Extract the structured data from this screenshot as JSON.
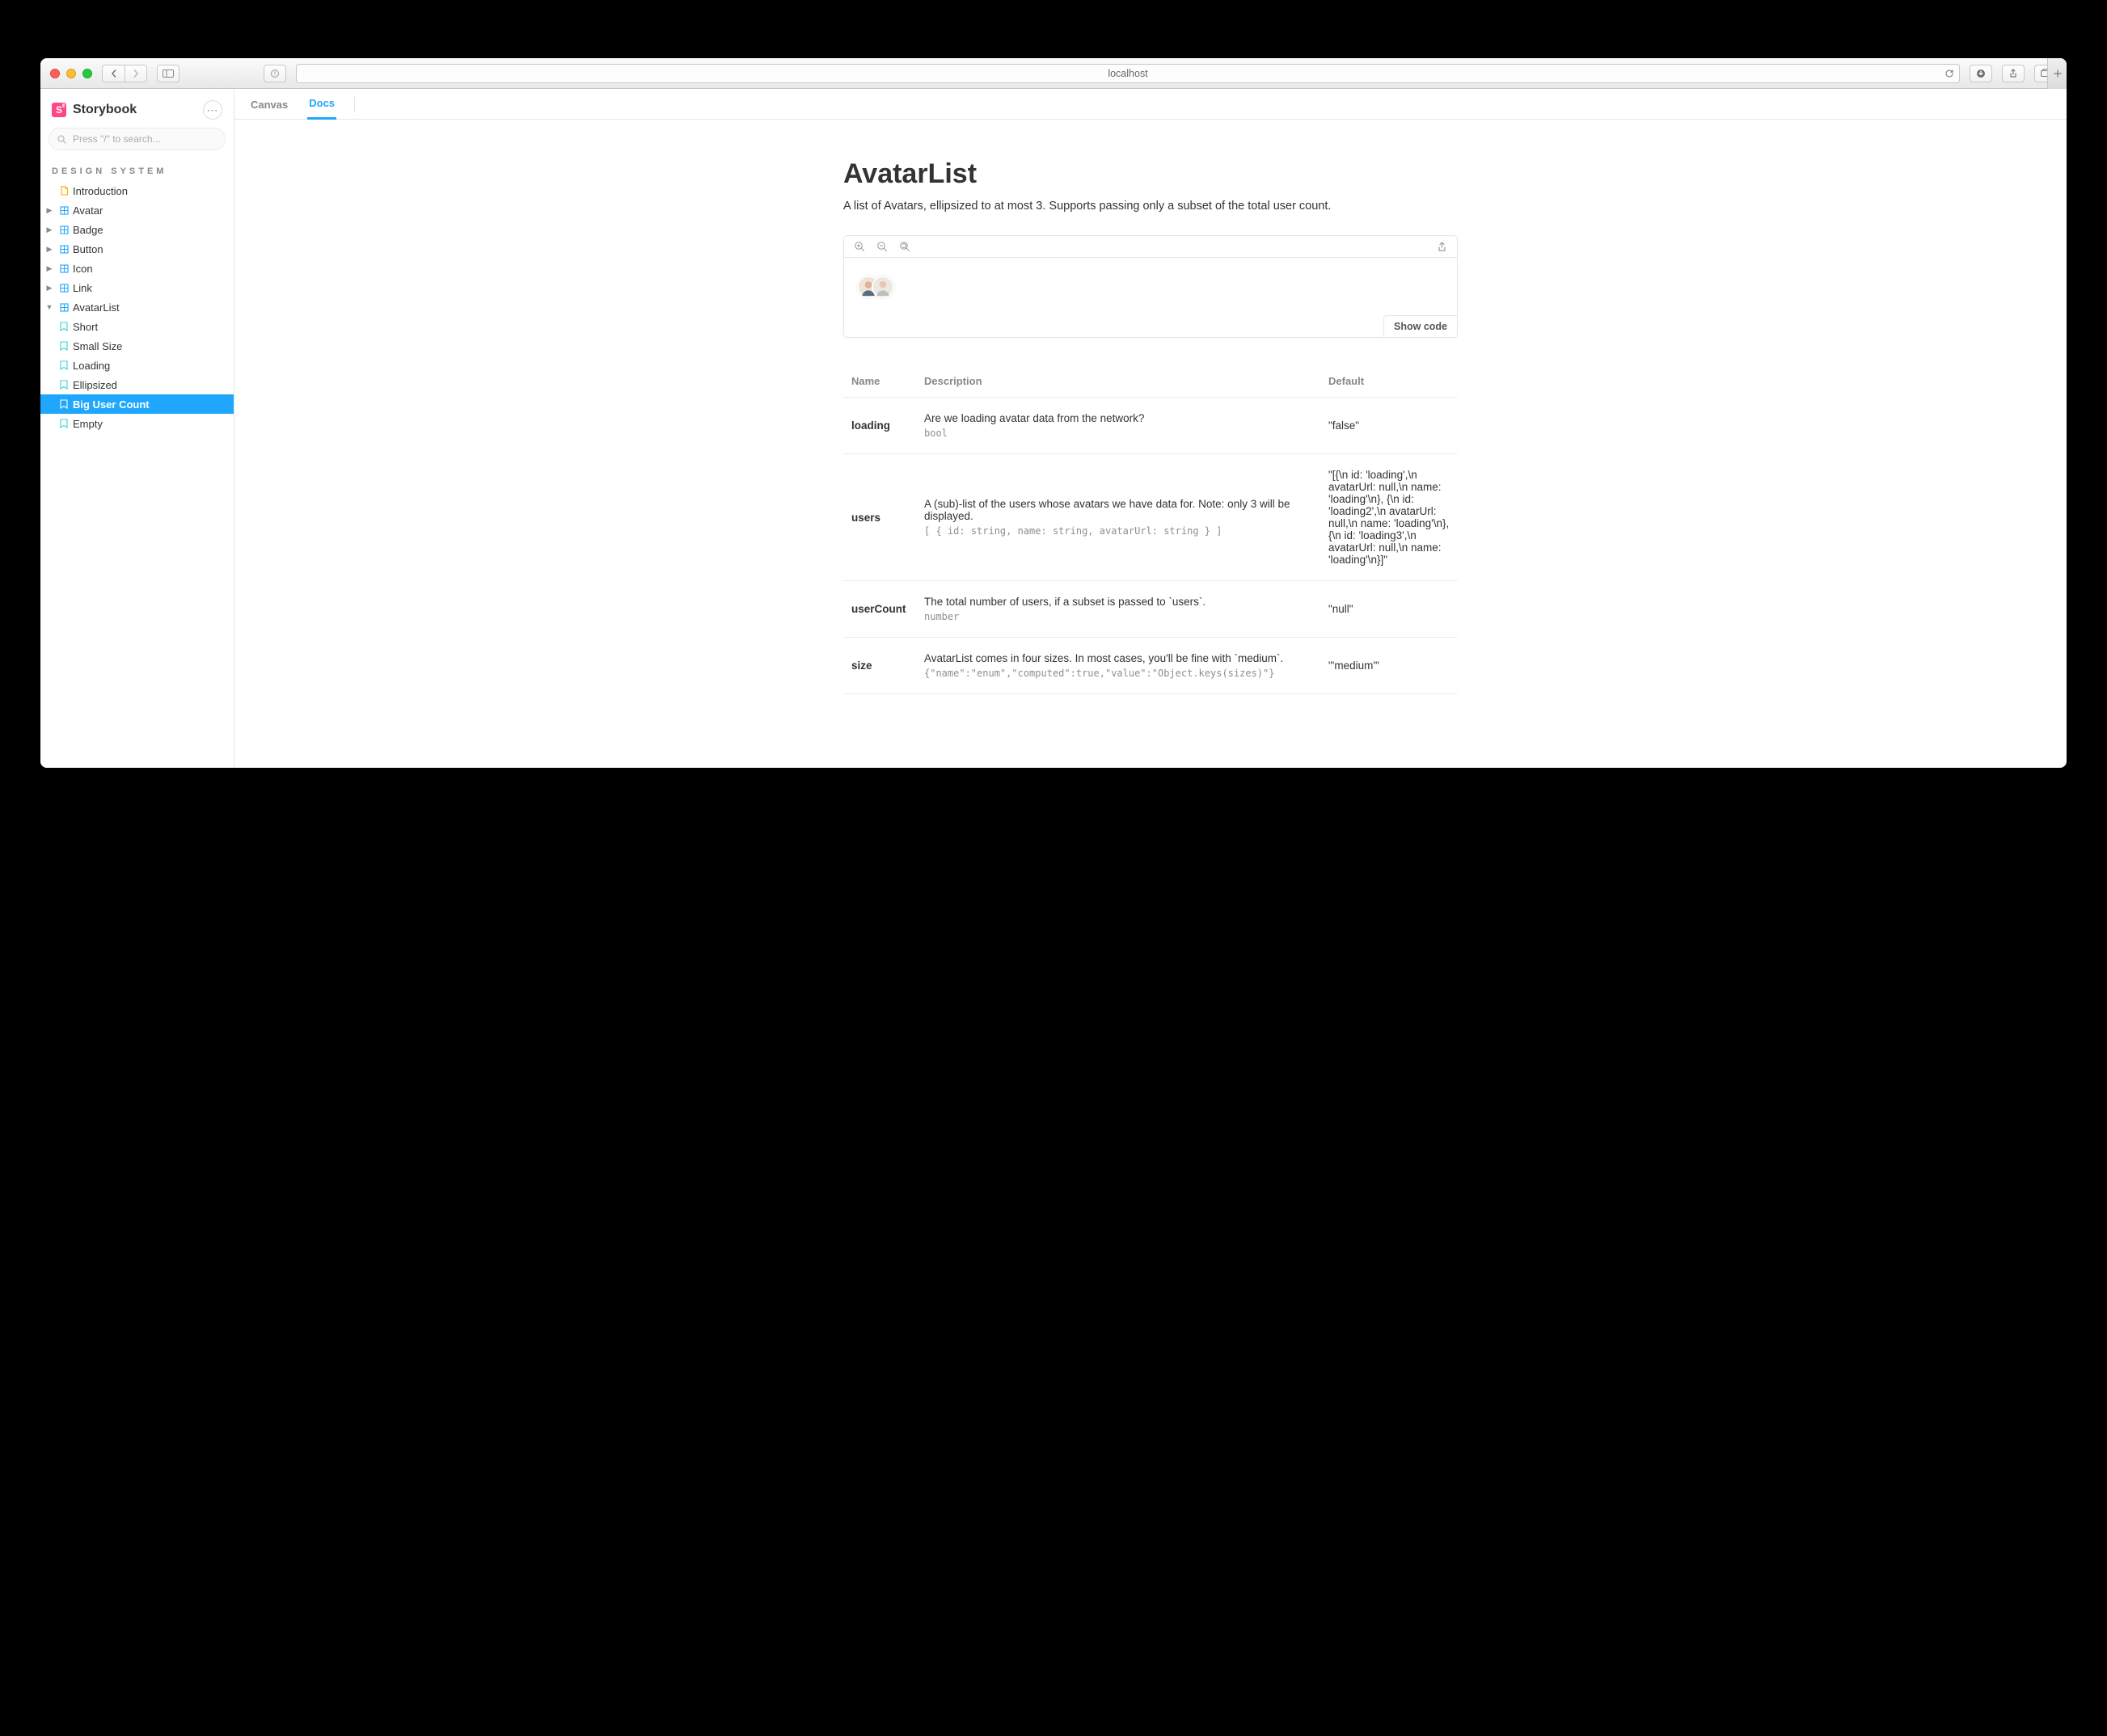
{
  "browser": {
    "url": "localhost"
  },
  "brand": {
    "name": "Storybook",
    "logo_letter": "S"
  },
  "search": {
    "placeholder": "Press \"/\" to search..."
  },
  "section_title": "DESIGN SYSTEM",
  "nav": {
    "introduction": "Introduction",
    "avatar": "Avatar",
    "badge": "Badge",
    "button": "Button",
    "icon": "Icon",
    "link": "Link",
    "avatarlist": "AvatarList",
    "stories": {
      "short": "Short",
      "small_size": "Small Size",
      "loading": "Loading",
      "ellipsized": "Ellipsized",
      "big_user_count": "Big User Count",
      "empty": "Empty"
    }
  },
  "tabs": {
    "canvas": "Canvas",
    "docs": "Docs"
  },
  "doc": {
    "title": "AvatarList",
    "lede": "A list of Avatars, ellipsized to at most 3. Supports passing only a subset of the total user count.",
    "show_code": "Show code"
  },
  "props": {
    "headers": {
      "name": "Name",
      "description": "Description",
      "default": "Default"
    },
    "rows": [
      {
        "name": "loading",
        "desc": "Are we loading avatar data from the network?",
        "type": "bool",
        "default": "\"false\""
      },
      {
        "name": "users",
        "desc": "A (sub)-list of the users whose avatars we have data for. Note: only 3 will be displayed.",
        "type": "[ { id: string, name: string, avatarUrl: string } ]",
        "default": "\"[{\\n id: 'loading',\\n avatarUrl: null,\\n name: 'loading'\\n}, {\\n id: 'loading2',\\n avatarUrl: null,\\n name: 'loading'\\n}, {\\n id: 'loading3',\\n avatarUrl: null,\\n name: 'loading'\\n}]\""
      },
      {
        "name": "userCount",
        "desc": "The total number of users, if a subset is passed to `users`.",
        "type": "number",
        "default": "\"null\""
      },
      {
        "name": "size",
        "desc": "AvatarList comes in four sizes. In most cases, you'll be fine with `medium`.",
        "type": "{\"name\":\"enum\",\"computed\":true,\"value\":\"Object.keys(sizes)\"}",
        "default": "\"'medium'\""
      }
    ]
  }
}
